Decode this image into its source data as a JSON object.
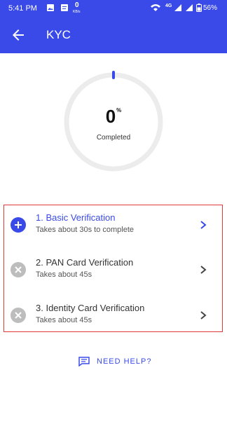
{
  "status_bar": {
    "time": "5:41 PM",
    "network_speed": "0",
    "network_unit": "KB/s",
    "signal_text": "4G",
    "battery_text": "56%",
    "icons": [
      "image-icon",
      "message-icon",
      "wifi-icon",
      "signal-icon",
      "battery-icon"
    ]
  },
  "app_bar": {
    "title": "KYC",
    "back_icon": "arrow-left-icon"
  },
  "progress": {
    "value": "0",
    "unit": "%",
    "label": "Completed",
    "fraction": 0.0
  },
  "steps": [
    {
      "title": "1. Basic Verification",
      "subtitle": "Takes about 30s to complete",
      "status_icon": "plus-circle-icon",
      "state": "active"
    },
    {
      "title": "2. PAN Card Verification",
      "subtitle": "Takes about 45s",
      "status_icon": "x-circle-icon",
      "state": "disabled"
    },
    {
      "title": "3. Identity Card Verification",
      "subtitle": "Takes about 45s",
      "status_icon": "x-circle-icon",
      "state": "disabled"
    }
  ],
  "help": {
    "label": "NEED HELP?",
    "icon": "chat-icon"
  },
  "colors": {
    "primary": "#3a4ae8",
    "highlight_border": "#e03a3a",
    "disabled_icon": "#bdbdbd"
  }
}
